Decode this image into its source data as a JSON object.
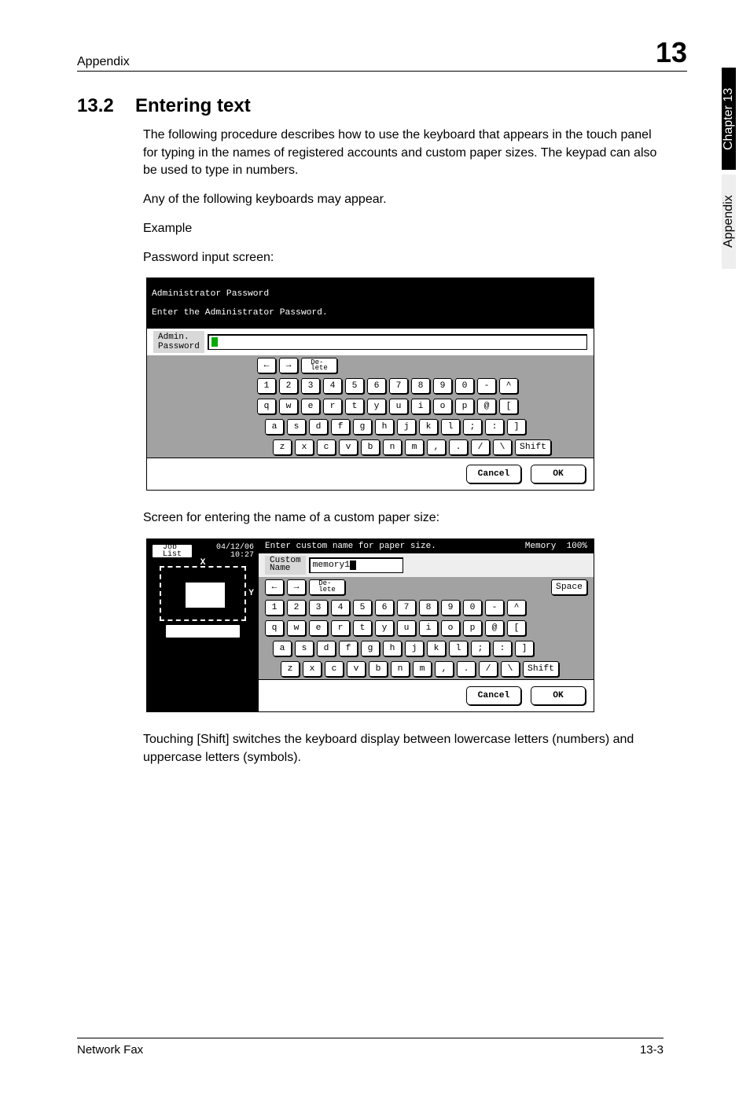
{
  "header": {
    "section": "Appendix",
    "chapter_number": "13"
  },
  "side_tabs": {
    "dark": "Chapter 13",
    "light": "Appendix"
  },
  "section": {
    "number": "13.2",
    "title": "Entering text"
  },
  "paragraphs": {
    "intro": "The following procedure describes how to use the keyboard that appears in the touch panel for typing in the names of registered accounts and custom paper sizes. The keypad can also be used to type in numbers.",
    "any_keyboard": "Any of the following keyboards may appear.",
    "example": "Example",
    "pwd_caption": "Password input screen:",
    "custom_caption": "Screen for entering the name of a custom paper size:",
    "shift_note": "Touching [Shift] switches the keyboard display between lowercase letters (numbers) and uppercase letters (symbols)."
  },
  "panel1": {
    "title_line1": "Administrator Password",
    "title_line2": "Enter the Administrator Password.",
    "field_label": "Admin.\nPassword",
    "arrows": {
      "left": "←",
      "right": "→"
    },
    "delete_key": "De-\nlete",
    "rows": {
      "num": [
        "1",
        "2",
        "3",
        "4",
        "5",
        "6",
        "7",
        "8",
        "9",
        "0",
        "-",
        "^"
      ],
      "r1": [
        "q",
        "w",
        "e",
        "r",
        "t",
        "y",
        "u",
        "i",
        "o",
        "p",
        "@",
        "["
      ],
      "r2": [
        "a",
        "s",
        "d",
        "f",
        "g",
        "h",
        "j",
        "k",
        "l",
        ";",
        ":",
        "]"
      ],
      "r3": [
        "z",
        "x",
        "c",
        "v",
        "b",
        "n",
        "m",
        ",",
        ".",
        "/",
        "\\"
      ]
    },
    "shift": "Shift",
    "cancel": "Cancel",
    "ok": "OK"
  },
  "panel2": {
    "job_list": "Job\nList",
    "datetime": "04/12/06\n10:27",
    "titlebar_msg": "Enter custom name for paper size.",
    "memory_label": "Memory",
    "memory_value": "100%",
    "custom_label": "Custom\nName",
    "input_value": "memory1",
    "axis": {
      "x": "X",
      "y": "Y"
    },
    "arrows": {
      "left": "←",
      "right": "→"
    },
    "delete_key": "De-\nlete",
    "space_key": "Space",
    "rows": {
      "num": [
        "1",
        "2",
        "3",
        "4",
        "5",
        "6",
        "7",
        "8",
        "9",
        "0",
        "-",
        "^"
      ],
      "r1": [
        "q",
        "w",
        "e",
        "r",
        "t",
        "y",
        "u",
        "i",
        "o",
        "p",
        "@",
        "["
      ],
      "r2": [
        "a",
        "s",
        "d",
        "f",
        "g",
        "h",
        "j",
        "k",
        "l",
        ";",
        ":",
        "]"
      ],
      "r3": [
        "z",
        "x",
        "c",
        "v",
        "b",
        "n",
        "m",
        ",",
        ".",
        "/",
        "\\"
      ]
    },
    "shift": "Shift",
    "cancel": "Cancel",
    "ok": "OK"
  },
  "footer": {
    "left": "Network Fax",
    "right": "13-3"
  }
}
